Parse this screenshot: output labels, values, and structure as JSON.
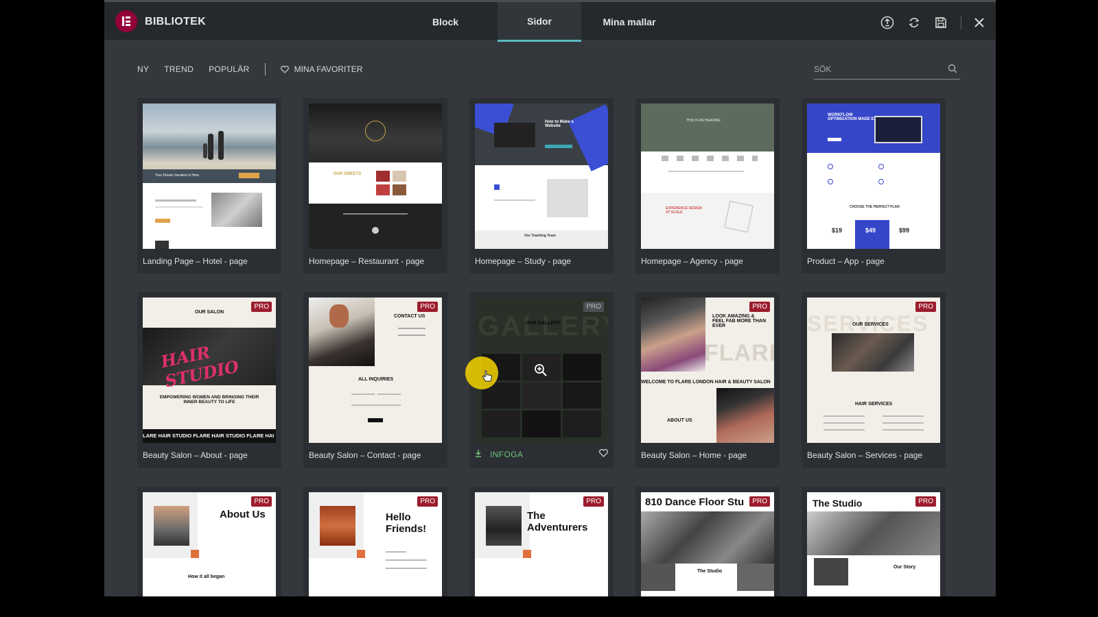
{
  "app": {
    "title": "BIBLIOTEK"
  },
  "tabs": [
    {
      "label": "Block"
    },
    {
      "label": "Sidor"
    },
    {
      "label": "Mina mallar"
    }
  ],
  "header_icons": [
    "info-icon",
    "sync-icon",
    "save-icon",
    "close-icon"
  ],
  "filters": [
    {
      "label": "NY"
    },
    {
      "label": "TREND"
    },
    {
      "label": "POPULÄR"
    }
  ],
  "favorites_label": "MINA FAVORITER",
  "search": {
    "placeholder": "SÖK"
  },
  "pro_label": "PRO",
  "insert_label": "INFOGA",
  "thumb_texts": {
    "hotel": "Your Dream Vacation is Here",
    "restaurant": "OUR SWEETS",
    "study": "How to Make a Website",
    "study_team": "Our Teaching Team",
    "agency": "THIS IS AN HEADING",
    "agency2": "EXPERIENCE DESIGN AT SCALE",
    "app": "WORKFLOW OPTIMIZATION MADE EASY",
    "app_plan": "CHOOSE THE PERFECT PLAN",
    "price1": "$19",
    "price2": "$49",
    "price3": "$99",
    "salon_about_head": "OUR SALON",
    "salon_about_neon": "HAIR STUDIO",
    "salon_about_tag": "EMPOWERING WOMEN AND BRINGING THEIR INNER BEAUTY TO LIFE",
    "salon_about_ticker": "LARE HAIR STUDIO FLARE HAIR STUDIO FLARE HAI",
    "contact_head": "CONTACT US",
    "contact_inq": "ALL INQUIRIES",
    "gallery_bg": "GALLERY",
    "gallery_head": "OUR GALLERY",
    "home_head": "LOOK AMAZING & FEEL FAB MORE THAN EVER",
    "home_flare": "FLARE",
    "home_welcome": "WELCOME TO FLARE LONDON HAIR & BEAUTY SALON",
    "home_about": "ABOUT US",
    "services_bg": "SERVICES",
    "services_head": "OUR SERVICES",
    "services_hair": "HAIR SERVICES",
    "about_us": "About Us",
    "about_began": "How it all began",
    "hello": "Hello Friends!",
    "adventurers": "The Adventurers",
    "dance": "810 Dance Floor Stu",
    "dance_sub": "The Studio",
    "studio": "The Studio",
    "studio_story": "Our Story"
  },
  "cards": [
    {
      "title": "Landing Page – Hotel - page"
    },
    {
      "title": "Homepage – Restaurant - page"
    },
    {
      "title": "Homepage – Study - page"
    },
    {
      "title": "Homepage – Agency - page"
    },
    {
      "title": "Product – App - page"
    },
    {
      "title": "Beauty Salon – About - page"
    },
    {
      "title": "Beauty Salon – Contact - page"
    },
    {
      "title": ""
    },
    {
      "title": "Beauty Salon – Home - page"
    },
    {
      "title": "Beauty Salon – Services - page"
    }
  ],
  "colors": {
    "accent": "#5ab9c5",
    "brand": "#93003a",
    "pro": "#9c1c2d",
    "insert": "#6ec27a"
  }
}
